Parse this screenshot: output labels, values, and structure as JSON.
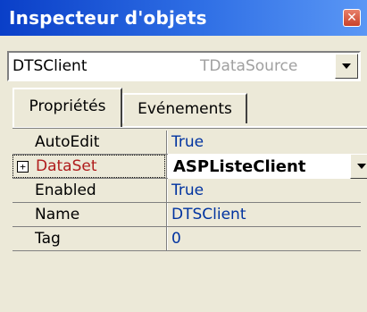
{
  "window": {
    "title": "Inspecteur d'objets",
    "close_icon_glyph": "✕"
  },
  "component_selector": {
    "name": "DTSClient",
    "type": "TDataSource"
  },
  "tabs": [
    {
      "label": "Propriétés",
      "active": true
    },
    {
      "label": "Evénements",
      "active": false
    }
  ],
  "properties": [
    {
      "name": "AutoEdit",
      "value": "True"
    },
    {
      "name": "DataSet",
      "value": "ASPListeClient",
      "expandable": true,
      "expand_glyph": "+",
      "selected": true
    },
    {
      "name": "Enabled",
      "value": "True"
    },
    {
      "name": "Name",
      "value": "DTSClient"
    },
    {
      "name": "Tag",
      "value": "0"
    }
  ],
  "colors": {
    "title_bar_start": "#0a3fc8",
    "title_bar_end": "#5a97f5",
    "panel_bg": "#ece9d8",
    "value_text": "#0033a0",
    "selected_name": "#b01c1c"
  }
}
